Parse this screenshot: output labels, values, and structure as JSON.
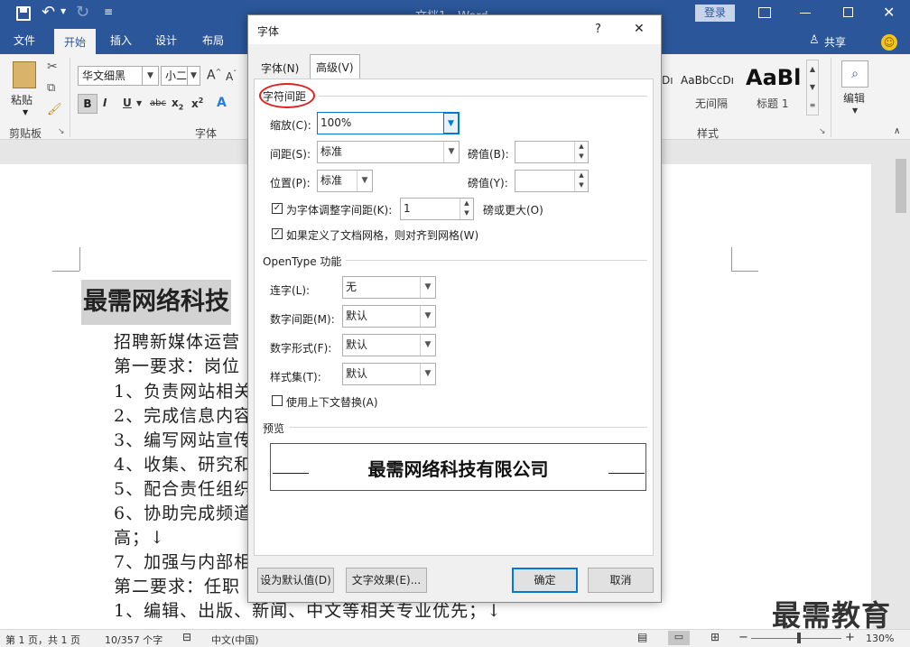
{
  "titlebar": {
    "title": "文档1 - Word",
    "login": "登录",
    "save_icon": "save-icon",
    "undo_icon": "undo-icon",
    "redo_icon": "redo-icon",
    "qat_icon": "customize-qat-icon"
  },
  "tabs": [
    "文件",
    "开始",
    "插入",
    "设计",
    "布局"
  ],
  "share_label": "共享",
  "ribbon": {
    "paste_label": "粘贴",
    "clipboard_label": "剪贴板",
    "font_name": "华文细黑",
    "font_size": "小二",
    "font_group_label": "字体",
    "styles": [
      {
        "preview": "AaBbCcDı",
        "name": "无间隔"
      },
      {
        "preview": "AaBl",
        "name": "标题 1"
      }
    ],
    "styles_group_label": "样式",
    "edit_label": "编辑",
    "partial_style_preview": "Dı"
  },
  "document": {
    "heading": "最需网络科技",
    "lines": [
      "招聘新媒体运营",
      "第一要求：岗位",
      "1、负责网站相关",
      "2、完成信息内容",
      "3、编写网站宣传",
      "4、收集、研究和",
      "5、配合责任组织",
      "6、协助完成频道",
      "高；↓",
      "7、加强与内部相",
      "第二要求：任职",
      "1、编辑、出版、新闻、中文等相关专业优先；↓"
    ]
  },
  "dialog": {
    "title": "字体",
    "help": "?",
    "close": "✕",
    "tabs": [
      "字体(N)",
      "高级(V)"
    ],
    "spacing_section": "字符间距",
    "scale_label": "缩放(C):",
    "scale_value": "100%",
    "spacing_label": "间距(S):",
    "spacing_value": "标准",
    "spacing_by_label": "磅值(B):",
    "spacing_by_value": "",
    "position_label": "位置(P):",
    "position_value": "标准",
    "position_by_label": "磅值(Y):",
    "position_by_value": "",
    "kerning_label": "为字体调整字间距(K):",
    "kerning_value": "1",
    "kerning_suffix": "磅或更大(O)",
    "kerning_checked": true,
    "grid_label": "如果定义了文档网格，则对齐到网格(W)",
    "grid_checked": true,
    "opentype_section": "OpenType 功能",
    "ligatures_label": "连字(L):",
    "ligatures_value": "无",
    "numspacing_label": "数字间距(M):",
    "numspacing_value": "默认",
    "numforms_label": "数字形式(F):",
    "numforms_value": "默认",
    "stylesets_label": "样式集(T):",
    "stylesets_value": "默认",
    "contextual_label": "使用上下文替换(A)",
    "contextual_checked": false,
    "preview_section": "预览",
    "preview_text": "最需网络科技有限公司",
    "set_default": "设为默认值(D)",
    "text_effects": "文字效果(E)...",
    "ok": "确定",
    "cancel": "取消"
  },
  "status": {
    "page": "第 1 页，共 1 页",
    "words": "10/357 个字",
    "lang": "中文(中国)",
    "zoom": "130%"
  },
  "watermark": "最需教育",
  "colors": {
    "word_blue": "#2b579a",
    "highlight_red": "#e02020",
    "ok_border": "#0078d7"
  }
}
